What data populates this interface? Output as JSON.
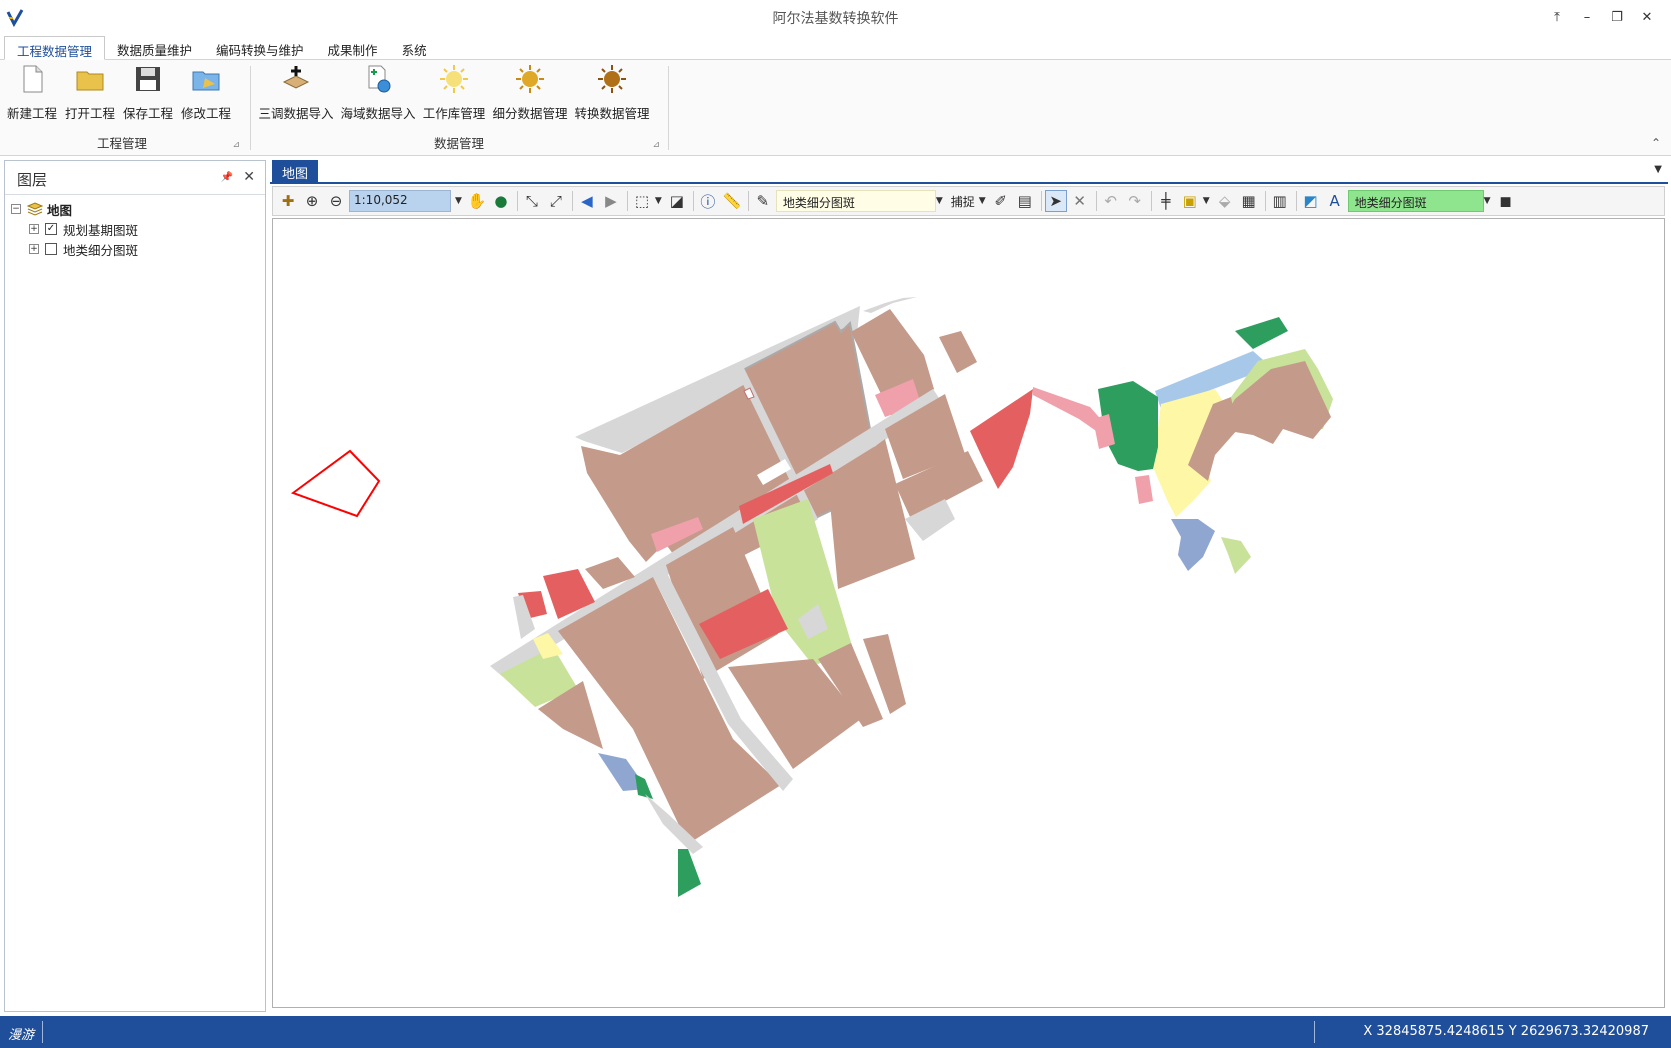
{
  "app": {
    "title": "阿尔法基数转换软件"
  },
  "window_controls": [
    "restore-up-icon",
    "minimize-icon",
    "restore-icon",
    "close-icon"
  ],
  "tabs": [
    {
      "label": "工程数据管理",
      "active": true
    },
    {
      "label": "数据质量维护"
    },
    {
      "label": "编码转换与维护"
    },
    {
      "label": "成果制作"
    },
    {
      "label": "系统"
    }
  ],
  "ribbon": {
    "groups": [
      {
        "label": "工程管理",
        "buttons": [
          {
            "label": "新建工程",
            "icon": "new-document-icon"
          },
          {
            "label": "打开工程",
            "icon": "open-folder-icon"
          },
          {
            "label": "保存工程",
            "icon": "save-disk-icon"
          },
          {
            "label": "修改工程",
            "icon": "edit-folder-icon"
          }
        ]
      },
      {
        "label": "数据管理",
        "buttons": [
          {
            "label": "三调数据导入",
            "icon": "import-map-icon"
          },
          {
            "label": "海域数据导入",
            "icon": "import-sea-icon"
          },
          {
            "label": "工作库管理",
            "icon": "sun-light-icon"
          },
          {
            "label": "细分数据管理",
            "icon": "sun-gold-icon"
          },
          {
            "label": "转换数据管理",
            "icon": "sun-dark-icon"
          }
        ]
      }
    ]
  },
  "layers_panel": {
    "title": "图层",
    "root": "地图",
    "layers": [
      {
        "name": "规划基期图斑",
        "checked": true
      },
      {
        "name": "地类细分图斑",
        "checked": false
      }
    ]
  },
  "map": {
    "tab": "地图",
    "scale": "1:10,052",
    "layer_combo": "地类细分图斑",
    "snap_label": "捕捉",
    "target_combo": "地类细分图斑"
  },
  "status": {
    "mode": "漫游",
    "coordinates": "X 32845875.4248615 Y 2629673.32420987"
  },
  "colors": {
    "accent": "#1f4e9b",
    "urban": "#c49a8a",
    "road": "#d7d7d7",
    "residential": "#e46060",
    "commercial": "#f0a0aa",
    "grassland": "#c9e29a",
    "forest": "#2e9e5e",
    "farmland": "#fdf7a6",
    "water": "#8fa7d0",
    "outline": "#ff0000"
  }
}
